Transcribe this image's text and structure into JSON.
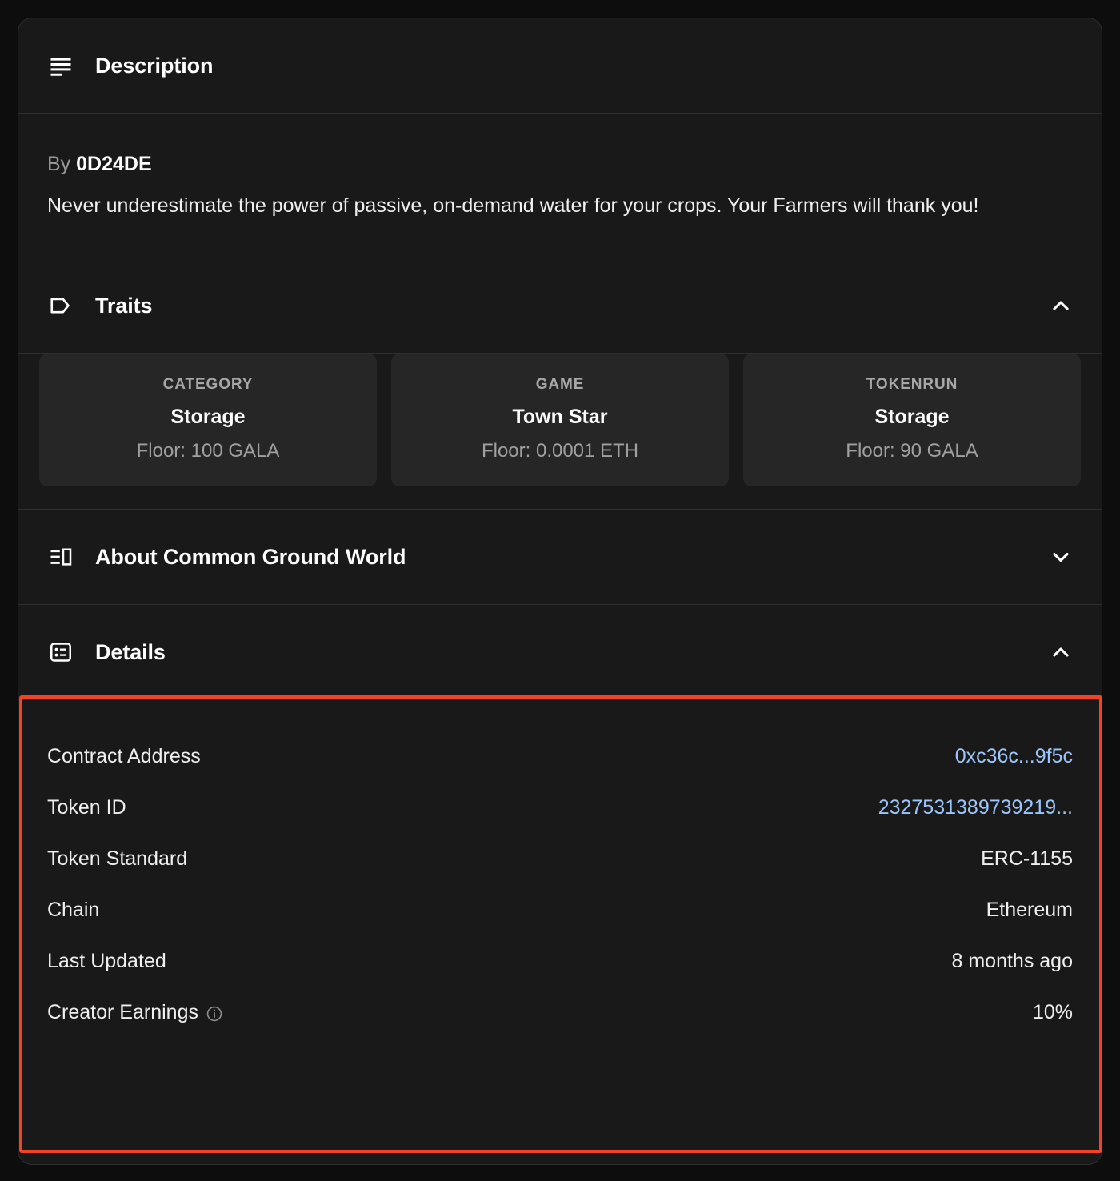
{
  "colors": {
    "page_background": "#0d0d0d",
    "panel_background": "#191919",
    "card_background": "#262626",
    "divider": "#2f2f2f",
    "text_primary": "#efefef",
    "text_muted": "#a0a0a0",
    "link": "#9cc6fb",
    "highlight_border": "#f04425"
  },
  "description": {
    "title": "Description",
    "icon": "text-lines-icon",
    "by_label": "By",
    "by_name": "0D24DE",
    "body": "Never underestimate the power of passive, on-demand water for your crops. Your Farmers will thank you!"
  },
  "traits": {
    "title": "Traits",
    "icon": "tag-icon",
    "chevron": "chevron-up-icon",
    "expanded": true,
    "items": [
      {
        "type": "CATEGORY",
        "value": "Storage",
        "floor": "Floor: 100 GALA"
      },
      {
        "type": "GAME",
        "value": "Town Star",
        "floor": "Floor: 0.0001 ETH"
      },
      {
        "type": "TOKENRUN",
        "value": "Storage",
        "floor": "Floor: 90 GALA"
      }
    ]
  },
  "about": {
    "title": "About Common Ground World",
    "icon": "layout-columns-icon",
    "chevron": "chevron-down-icon",
    "expanded": false
  },
  "details": {
    "title": "Details",
    "icon": "list-box-icon",
    "chevron": "chevron-up-icon",
    "expanded": true,
    "highlighted": true,
    "rows": [
      {
        "label": "Contract Address",
        "value": "0xc36c...9f5c",
        "is_link": true,
        "has_info": false
      },
      {
        "label": "Token ID",
        "value": "2327531389739219...",
        "is_link": true,
        "has_info": false
      },
      {
        "label": "Token Standard",
        "value": "ERC-1155",
        "is_link": false,
        "has_info": false
      },
      {
        "label": "Chain",
        "value": "Ethereum",
        "is_link": false,
        "has_info": false
      },
      {
        "label": "Last Updated",
        "value": "8 months ago",
        "is_link": false,
        "has_info": false
      },
      {
        "label": "Creator Earnings",
        "value": "10%",
        "is_link": false,
        "has_info": true,
        "info_icon": "info-circle-icon"
      }
    ]
  }
}
